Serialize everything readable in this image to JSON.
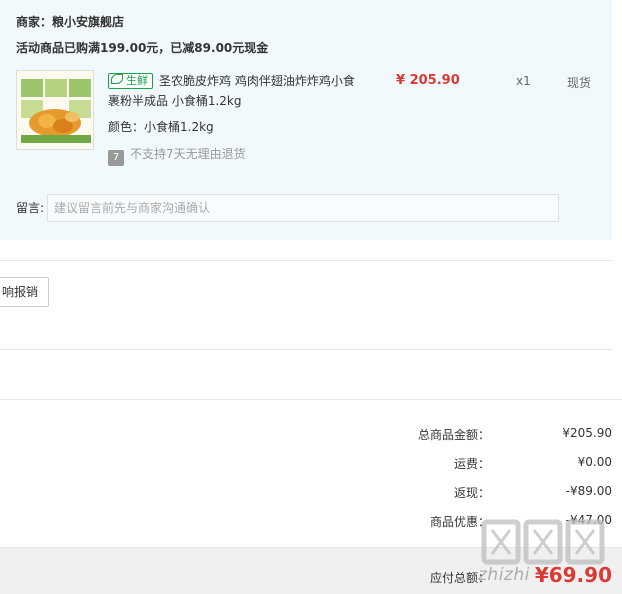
{
  "shop": {
    "merchant": "商家：粮小安旗舰店",
    "promotion": "活动商品已购满199.00元，已减89.00元现金"
  },
  "item": {
    "tag": "生鲜",
    "title": "圣农脆皮炸鸡 鸡肉伴翅油炸炸鸡小食裹粉半成品 小食桶1.2kg",
    "color": "颜色：小食桶1.2kg",
    "price": "¥ 205.90",
    "qty": "x1",
    "stock": "现货",
    "badge": "7",
    "no_return": "不支持7天无理由退货"
  },
  "remark": {
    "label": "留言:",
    "placeholder": "建议留言前先与商家沟通确认"
  },
  "report_button": "响报销",
  "summary": [
    {
      "label": "总商品金额：",
      "value": "¥205.90"
    },
    {
      "label": "运费：",
      "value": "¥0.00"
    },
    {
      "label": "返现：",
      "value": "-¥89.00"
    },
    {
      "label": "商品优惠：",
      "value": "-¥47.00"
    }
  ],
  "payable": {
    "label": "应付总额：",
    "value": "¥69.90"
  },
  "watermark": {
    "text": "zhizhi"
  },
  "colors": {
    "shop_bg": "#f1f9fd",
    "price_red": "#d93a34",
    "fresh_green": "#16a34a"
  }
}
